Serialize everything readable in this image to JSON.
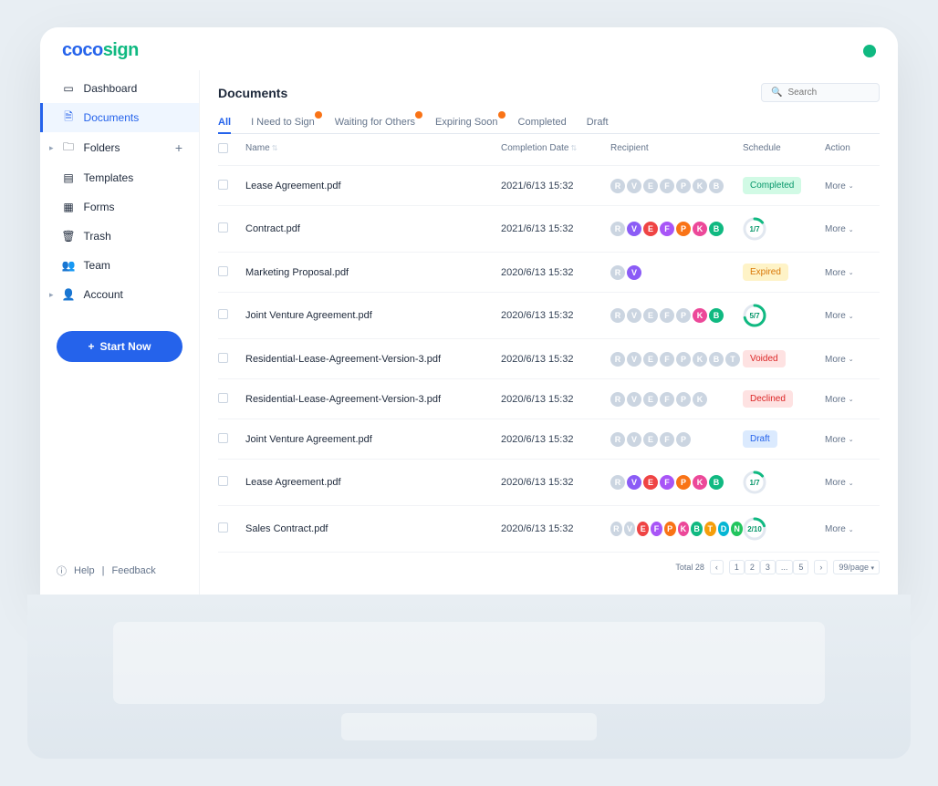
{
  "logo": {
    "part1": "coco",
    "part2": "sign"
  },
  "sidebar": {
    "items": [
      {
        "label": "Dashboard",
        "icon": "dashboard"
      },
      {
        "label": "Documents",
        "icon": "document",
        "active": true
      },
      {
        "label": "Folders",
        "icon": "folder",
        "expandable": true,
        "add": true
      },
      {
        "label": "Templates",
        "icon": "template"
      },
      {
        "label": "Forms",
        "icon": "form"
      },
      {
        "label": "Trash",
        "icon": "trash"
      },
      {
        "label": "Team",
        "icon": "team"
      },
      {
        "label": "Account",
        "icon": "account",
        "expandable": true
      }
    ],
    "start_now": "Start Now",
    "help": "Help",
    "feedback": "Feedback"
  },
  "page_title": "Documents",
  "search_placeholder": "Search",
  "tabs": [
    {
      "label": "All",
      "active": true
    },
    {
      "label": "I Need to Sign",
      "badge": true
    },
    {
      "label": "Waiting for Others",
      "badge": true
    },
    {
      "label": "Expiring Soon",
      "badge": true
    },
    {
      "label": "Completed"
    },
    {
      "label": "Draft"
    }
  ],
  "columns": {
    "name": "Name",
    "completion_date": "Completion Date",
    "recipient": "Recipient",
    "schedule": "Schedule",
    "action": "Action"
  },
  "action_label": "More",
  "recipient_colors": {
    "R": "#60a5fa",
    "V": "#8b5cf6",
    "E": "#ef4444",
    "F": "#a855f7",
    "P": "#f97316",
    "K": "#ec4899",
    "B": "#10b981",
    "T": "#f59e0b",
    "D": "#06b6d4",
    "N": "#22c55e"
  },
  "rows": [
    {
      "name": "Lease Agreement.pdf",
      "date": "2021/6/13  15:32",
      "recipients": [
        "R",
        "V",
        "E",
        "F",
        "P",
        "K",
        "B"
      ],
      "muted": true,
      "schedule": {
        "type": "pill",
        "text": "Completed",
        "class": "status-completed"
      }
    },
    {
      "name": "Contract.pdf",
      "date": "2021/6/13  15:32",
      "recipients": [
        "R",
        "V",
        "E",
        "F",
        "P",
        "K",
        "B"
      ],
      "muted_first": 1,
      "schedule": {
        "type": "ring",
        "text": "1/7",
        "pct": 14
      }
    },
    {
      "name": "Marketing Proposal.pdf",
      "date": "2020/6/13  15:32",
      "recipients": [
        "R",
        "V"
      ],
      "muted_first": 1,
      "schedule": {
        "type": "pill",
        "text": "Expired",
        "class": "status-expired"
      }
    },
    {
      "name": "Joint Venture Agreement.pdf",
      "date": "2020/6/13  15:32",
      "recipients": [
        "R",
        "V",
        "E",
        "F",
        "P",
        "K",
        "B"
      ],
      "muted": true,
      "colored_indices": [
        5,
        6
      ],
      "schedule": {
        "type": "ring",
        "text": "5/7",
        "pct": 71
      }
    },
    {
      "name": "Residential-Lease-Agreement-Version-3.pdf",
      "date": "2020/6/13  15:32",
      "recipients": [
        "R",
        "V",
        "E",
        "F",
        "P",
        "K",
        "B",
        "T"
      ],
      "muted": true,
      "schedule": {
        "type": "pill",
        "text": "Voided",
        "class": "status-voided"
      }
    },
    {
      "name": "Residential-Lease-Agreement-Version-3.pdf",
      "date": "2020/6/13  15:32",
      "recipients": [
        "R",
        "V",
        "E",
        "F",
        "P",
        "K"
      ],
      "muted": true,
      "schedule": {
        "type": "pill",
        "text": "Declined",
        "class": "status-declined"
      }
    },
    {
      "name": "Joint Venture Agreement.pdf",
      "date": "2020/6/13  15:32",
      "recipients": [
        "R",
        "V",
        "E",
        "F",
        "P"
      ],
      "muted": true,
      "schedule": {
        "type": "pill",
        "text": "Draft",
        "class": "status-draft"
      }
    },
    {
      "name": "Lease Agreement.pdf",
      "date": "2020/6/13  15:32",
      "recipients": [
        "R",
        "V",
        "E",
        "F",
        "P",
        "K",
        "B"
      ],
      "muted_first": 1,
      "schedule": {
        "type": "ring",
        "text": "1/7",
        "pct": 14
      }
    },
    {
      "name": "Sales Contract.pdf",
      "date": "2020/6/13  15:32",
      "recipients": [
        "R",
        "V",
        "E",
        "F",
        "P",
        "K",
        "B",
        "T",
        "D",
        "N"
      ],
      "muted_first": 2,
      "schedule": {
        "type": "ring",
        "text": "2/10",
        "pct": 20
      }
    }
  ],
  "pagination": {
    "total_label": "Total 28",
    "pages": [
      "1",
      "2",
      "3",
      "...",
      "5"
    ],
    "per_page": "99/page"
  }
}
